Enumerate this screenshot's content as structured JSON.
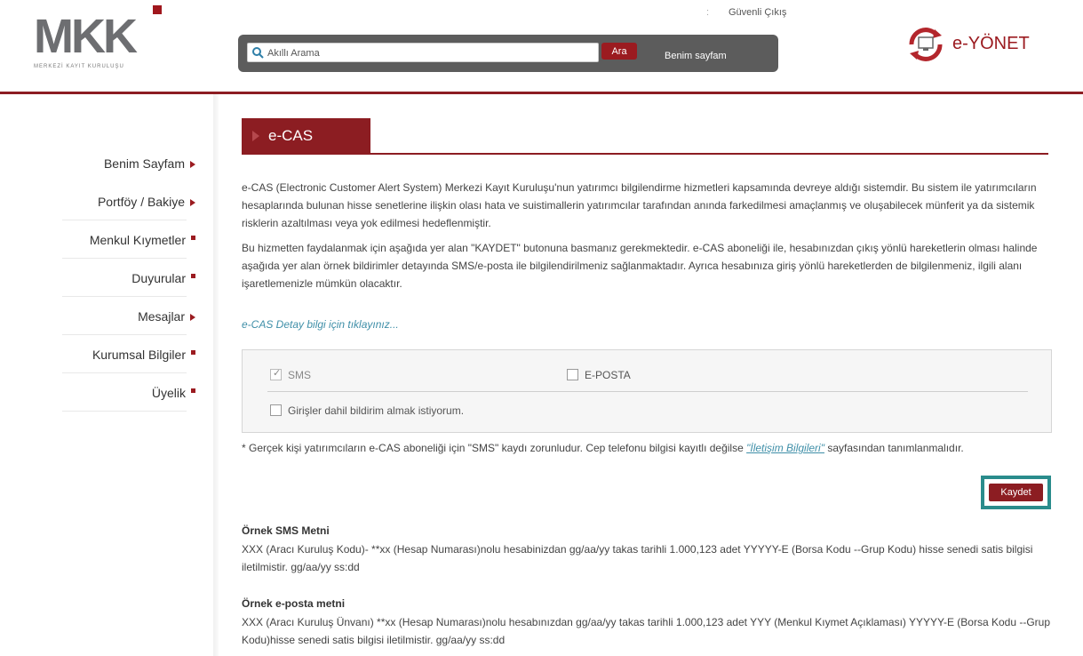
{
  "header": {
    "logo_text": "MKK",
    "logo_subtitle": "MERKEZİ KAYIT KURULUŞU",
    "top_separator": ":",
    "logout_label": "Güvenli Çıkış",
    "search_placeholder": "Akıllı Arama",
    "search_button": "Ara",
    "mypage_label": "Benim sayfam",
    "eyonet_label": "e-YÖNET"
  },
  "sidebar": {
    "items": [
      {
        "label": "Benim Sayfam",
        "marker": "arrow"
      },
      {
        "label": "Portföy / Bakiye",
        "marker": "arrow"
      },
      {
        "label": "Menkul Kıymetler",
        "marker": "square"
      },
      {
        "label": "Duyurular",
        "marker": "square"
      },
      {
        "label": "Mesajlar",
        "marker": "arrow"
      },
      {
        "label": "Kurumsal Bilgiler",
        "marker": "square"
      },
      {
        "label": "Üyelik",
        "marker": "square"
      }
    ]
  },
  "main": {
    "title": "e-CAS",
    "para1": "e-CAS (Electronic Customer Alert System) Merkezi Kayıt Kuruluşu'nun yatırımcı bilgilendirme hizmetleri kapsamında devreye aldığı sistemdir. Bu sistem ile yatırımcıların hesaplarında bulunan hisse senetlerine ilişkin olası hata ve suistimallerin yatırımcılar tarafından anında farkedilmesi amaçlanmış ve oluşabilecek münferit ya da sistemik risklerin azaltılması veya yok edilmesi hedeflenmiştir.",
    "para2": "Bu hizmetten faydalanmak için aşağıda yer alan \"KAYDET\" butonuna basmanız gerekmektedir. e-CAS aboneliği ile, hesabınızdan çıkış yönlü hareketlerin olması halinde aşağıda yer alan örnek bildirimler detayında SMS/e-posta ile bilgilendirilmeniz sağlanmaktadır. Ayrıca hesabınıza giriş yönlü hareketlerden de bilgilenmeniz, ilgili alanı işaretlemenizle mümkün olacaktır.",
    "detail_link": "e-CAS Detay bilgi için tıklayınız...",
    "options": {
      "sms_label": "SMS",
      "sms_checked": true,
      "email_label": "E-POSTA",
      "email_checked": false,
      "incoming_label": "Girişler dahil bildirim almak istiyorum.",
      "incoming_checked": false
    },
    "note_prefix": "* Gerçek kişi yatırımcıların e-CAS aboneliği için \"SMS\" kaydı zorunludur. Cep telefonu bilgisi kayıtlı değilse ",
    "note_link": "\"İletişim Bilgileri\"",
    "note_suffix": " sayfasından tanımlanmalıdır.",
    "save_button": "Kaydet",
    "sms_example_title": "Örnek SMS Metni",
    "sms_example_body": "XXX (Aracı Kuruluş Kodu)- **xx (Hesap Numarası)nolu hesabinizdan gg/aa/yy takas tarihli 1.000,123 adet YYYYY-E (Borsa Kodu --Grup Kodu) hisse senedi satis bilgisi iletilmistir. gg/aa/yy ss:dd",
    "email_example_title": "Örnek e-posta metni",
    "email_example_body": "XXX (Aracı Kuruluş Ünvanı) **xx (Hesap Numarası)nolu hesabınızdan gg/aa/yy takas tarihli 1.000,123 adet YYY (Menkul Kıymet Açıklaması) YYYYY-E (Borsa Kodu --Grup Kodu)hisse senedi satis bilgisi iletilmistir. gg/aa/yy ss:dd"
  },
  "colors": {
    "brand_red": "#8c1d22",
    "link_teal": "#3f8fa8",
    "highlight_frame": "#2a8c8c"
  }
}
